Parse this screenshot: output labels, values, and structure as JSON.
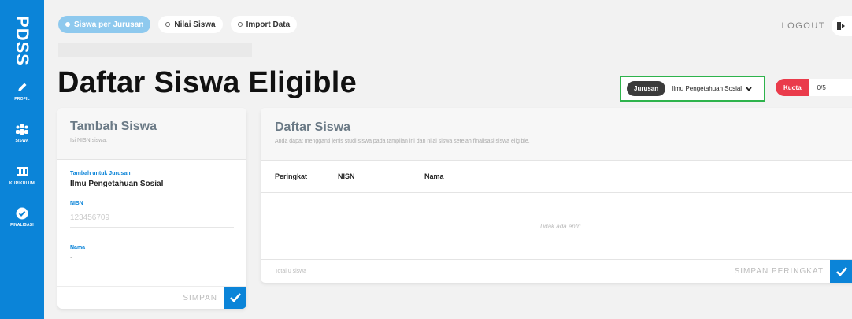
{
  "sidebar": {
    "brand": "PDSS",
    "items": [
      {
        "label": "PROFIL",
        "icon": "pencil-icon"
      },
      {
        "label": "SISWA",
        "icon": "users-icon"
      },
      {
        "label": "KURIKULUM",
        "icon": "books-icon"
      },
      {
        "label": "FINALISASI",
        "icon": "check-circle-icon"
      }
    ]
  },
  "tabs": [
    {
      "label": "Siswa per Jurusan",
      "active": true
    },
    {
      "label": "Nilai Siswa",
      "active": false
    },
    {
      "label": "Import Data",
      "active": false
    }
  ],
  "header": {
    "logout": "LOGOUT",
    "title": "Daftar Siswa Eligible"
  },
  "jurusan": {
    "label": "Jurusan",
    "selected": "Ilmu Pengetahuan Sosial"
  },
  "kuota": {
    "label": "Kuota",
    "value": "0/5"
  },
  "tambah": {
    "title": "Tambah Siswa",
    "subtitle": "Isi NISN siswa.",
    "jurusan_label": "Tambah untuk Jurusan",
    "jurusan_value": "Ilmu Pengetahuan Sosial",
    "nisn_label": "NISN",
    "nisn_placeholder": "123456709",
    "nama_label": "Nama",
    "nama_value": "-",
    "save": "SIMPAN"
  },
  "daftar": {
    "title": "Daftar Siswa",
    "subtitle": "Anda dapat mengganti jenis studi siswa pada tampilan ini dan nilai siswa setelah finalisasi siswa eligible.",
    "columns": [
      "Peringkat",
      "NISN",
      "Nama"
    ],
    "empty": "Tidak ada entri",
    "total": "Total 0 siswa",
    "save": "SIMPAN PERINGKAT"
  },
  "colors": {
    "primary": "#0b84d8",
    "accent_green": "#2eb34c",
    "quota_red": "#ea3b4b",
    "dark_pill": "#3b3b3b"
  }
}
